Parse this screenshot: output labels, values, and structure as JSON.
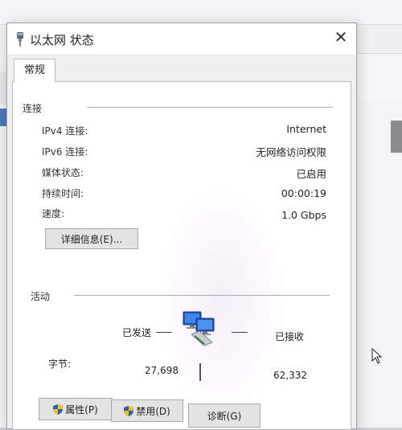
{
  "window": {
    "title": "以太网 状态",
    "close_glyph": "✕"
  },
  "tabs": [
    {
      "label": "常规"
    }
  ],
  "connection": {
    "section_label": "连接",
    "rows": [
      {
        "label": "IPv4 连接:",
        "value": "Internet"
      },
      {
        "label": "IPv6 连接:",
        "value": "无网络访问权限"
      },
      {
        "label": "媒体状态:",
        "value": "已启用"
      },
      {
        "label": "持续时间:",
        "value": "00:00:19"
      },
      {
        "label": "速度:",
        "value": "1.0 Gbps"
      }
    ],
    "details_button": "详细信息(E)..."
  },
  "activity": {
    "section_label": "活动",
    "sent_label": "已发送",
    "received_label": "已接收",
    "bytes_label": "字节:",
    "bytes_sent": "27,698",
    "bytes_received": "62,332"
  },
  "buttons": {
    "properties": "属性(P)",
    "disable": "禁用(D)",
    "diagnose": "诊断(G)"
  },
  "icons": {
    "title": "ethernet-plug-icon",
    "network": "network-computers-icon",
    "shield": "uac-shield-icon"
  },
  "colors": {
    "accent": "#4a78b8",
    "shield_blue": "#2b5fb4",
    "shield_yellow": "#f2c21b"
  }
}
